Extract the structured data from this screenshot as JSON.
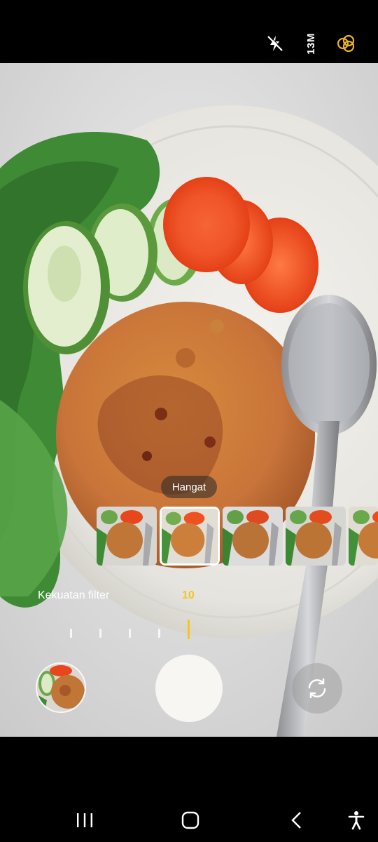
{
  "top_bar": {
    "flash_icon": "flash-off-icon",
    "resolution_label": "13M",
    "filter_icon": "filter-circles-icon"
  },
  "filter": {
    "selected_name": "Hangat",
    "thumbnail_count": 5,
    "selected_index": 1
  },
  "strength": {
    "label": "Kekuatan filter",
    "value": "10"
  },
  "controls": {
    "gallery_icon": "gallery-thumbnail",
    "shutter": "shutter-button",
    "switch_icon": "switch-camera-icon"
  },
  "nav": {
    "recents_icon": "recents-icon",
    "home_icon": "home-icon",
    "back_icon": "back-icon",
    "accessibility_icon": "accessibility-icon"
  },
  "colors": {
    "accent": "#f3c623",
    "filter_icon": "#e8b51f",
    "background": "#000000"
  }
}
